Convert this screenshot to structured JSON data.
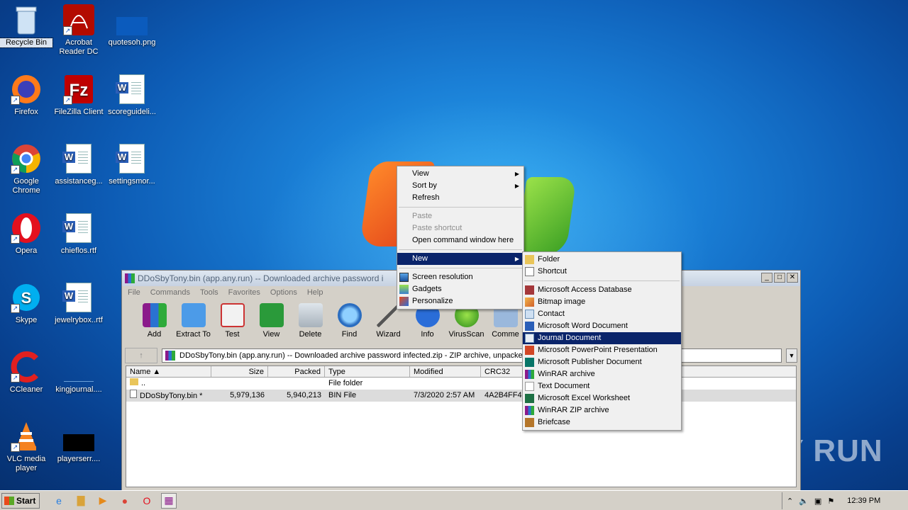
{
  "desktop_icons": [
    {
      "name": "recycle-bin",
      "label": "Recycle Bin",
      "icon": "recycle-bin-icon"
    },
    {
      "name": "acrobat-reader",
      "label": "Acrobat Reader DC",
      "icon": "acrobat-icon"
    },
    {
      "name": "quotesoh-png",
      "label": "quotesoh.png",
      "icon": "image-file-icon"
    },
    {
      "name": "firefox",
      "label": "Firefox",
      "icon": "firefox-icon"
    },
    {
      "name": "filezilla",
      "label": "FileZilla Client",
      "icon": "filezilla-icon"
    },
    {
      "name": "scoreguideli",
      "label": "scoreguideli...",
      "icon": "word-doc-icon"
    },
    {
      "name": "google-chrome",
      "label": "Google Chrome",
      "icon": "chrome-icon"
    },
    {
      "name": "assistanceg",
      "label": "assistanceg...",
      "icon": "word-doc-icon"
    },
    {
      "name": "settingsmor",
      "label": "settingsmor...",
      "icon": "word-doc-icon"
    },
    {
      "name": "opera",
      "label": "Opera",
      "icon": "opera-icon"
    },
    {
      "name": "chieflos",
      "label": "chieflos.rtf",
      "icon": "word-doc-icon"
    },
    {
      "name": "skype",
      "label": "Skype",
      "icon": "skype-icon"
    },
    {
      "name": "jewelrybox",
      "label": "jewelrybox..rtf",
      "icon": "word-doc-icon"
    },
    {
      "name": "ccleaner",
      "label": "CCleaner",
      "icon": "ccleaner-icon"
    },
    {
      "name": "kingjournal",
      "label": "kingjournal....",
      "icon": "blank-file-icon"
    },
    {
      "name": "vlc",
      "label": "VLC media player",
      "icon": "vlc-icon"
    },
    {
      "name": "playerserr",
      "label": "playerserr....",
      "icon": "black-file-icon"
    }
  ],
  "winrar": {
    "title": "DDoSbyTony.bin (app.any.run) -- Downloaded archive password i",
    "menu": [
      "File",
      "Commands",
      "Tools",
      "Favorites",
      "Options",
      "Help"
    ],
    "toolbar": [
      "Add",
      "Extract To",
      "Test",
      "View",
      "Delete",
      "Find",
      "Wizard",
      "Info",
      "VirusScan",
      "Comme"
    ],
    "address": "DDoSbyTony.bin (app.any.run) -- Downloaded archive password infected.zip - ZIP archive, unpacked",
    "columns": [
      "Name",
      "Size",
      "Packed",
      "Type",
      "Modified",
      "CRC32"
    ],
    "rows": [
      {
        "name": "..",
        "size": "",
        "packed": "",
        "type": "File folder",
        "modified": "",
        "crc": ""
      },
      {
        "name": "DDoSbyTony.bin *",
        "size": "5,979,136",
        "packed": "5,940,213",
        "type": "BIN File",
        "modified": "7/3/2020 2:57 AM",
        "crc": "4A2B4FF4"
      }
    ]
  },
  "context_menu": {
    "view": "View",
    "sort_by": "Sort by",
    "refresh": "Refresh",
    "paste": "Paste",
    "paste_shortcut": "Paste shortcut",
    "open_cmd": "Open command window here",
    "new": "New",
    "screen_resolution": "Screen resolution",
    "gadgets": "Gadgets",
    "personalize": "Personalize"
  },
  "new_submenu": {
    "folder": "Folder",
    "shortcut": "Shortcut",
    "items": [
      "Microsoft Access Database",
      "Bitmap image",
      "Contact",
      "Microsoft Word Document",
      "Journal Document",
      "Microsoft PowerPoint Presentation",
      "Microsoft Publisher Document",
      "WinRAR archive",
      "Text Document",
      "Microsoft Excel Worksheet",
      "WinRAR ZIP archive",
      "Briefcase"
    ],
    "highlighted": "Journal Document"
  },
  "taskbar": {
    "start": "Start",
    "clock": "12:39 PM"
  },
  "watermark": "ANY RUN"
}
